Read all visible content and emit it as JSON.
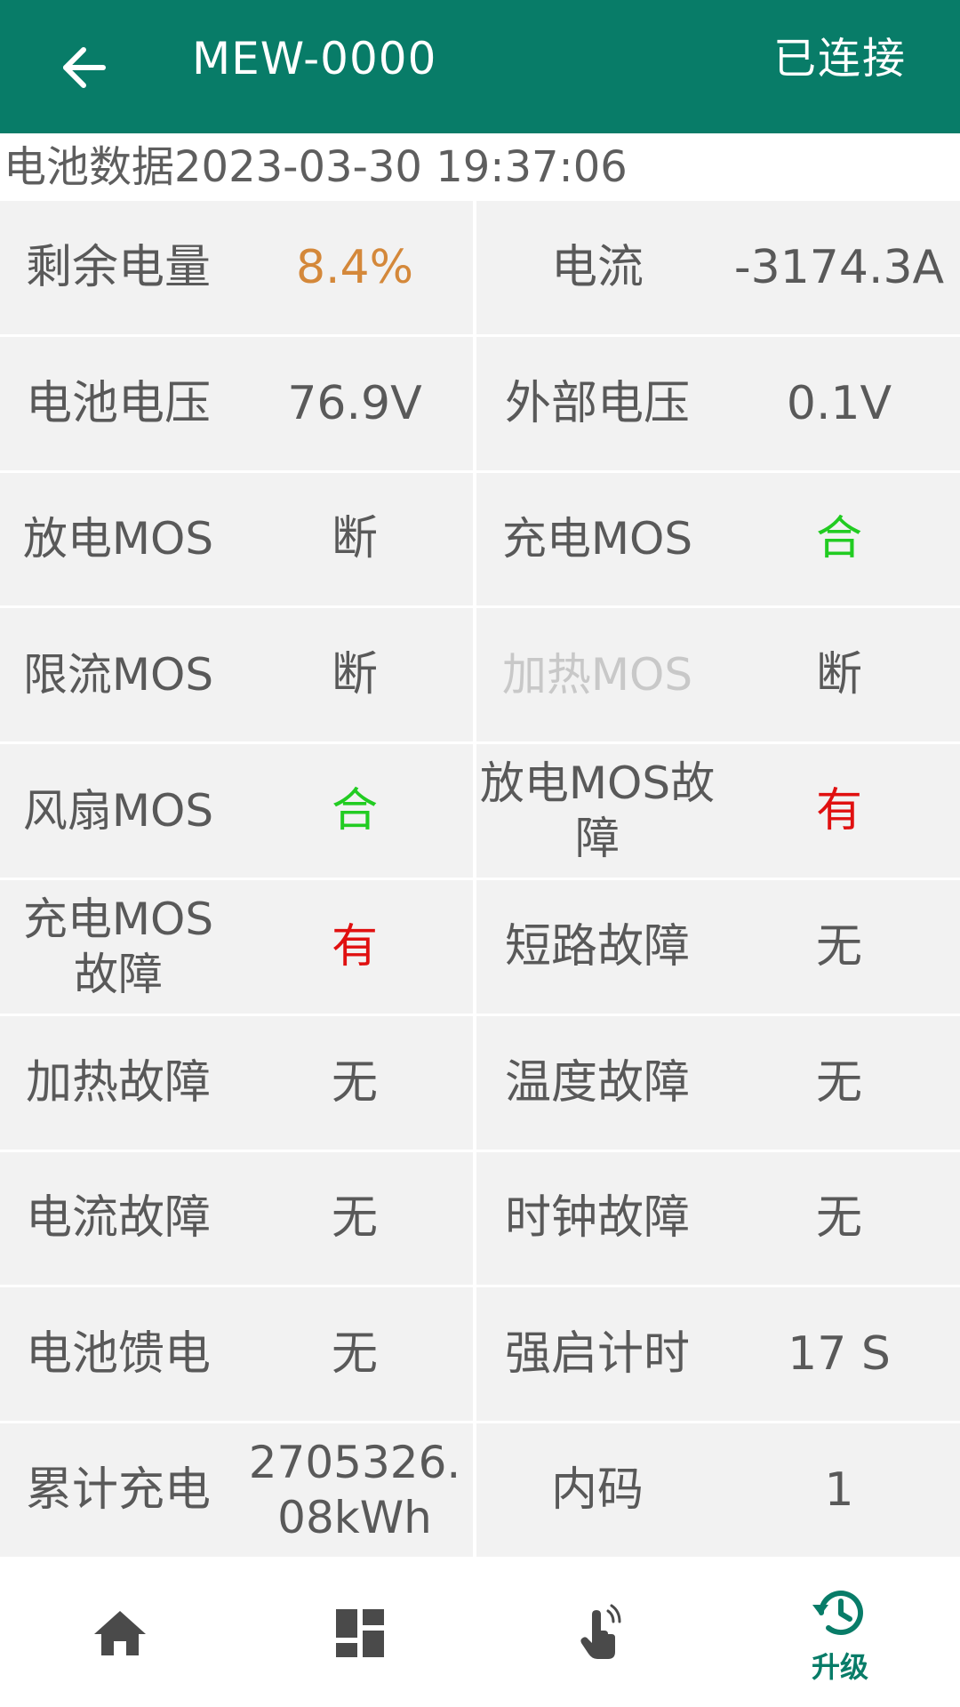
{
  "appbar": {
    "title": "MEW-0000",
    "status": "已连接",
    "back_icon": "arrow-left-icon",
    "bg_color": "#087c68"
  },
  "data_header": "电池数据2023-03-30 19:37:06",
  "cells": [
    {
      "label": "剩余电量",
      "value": "8.4%",
      "color": "#d4883a"
    },
    {
      "label": "电流",
      "value": "-3174.3A"
    },
    {
      "label": "电池电压",
      "value": "76.9V"
    },
    {
      "label": "外部电压",
      "value": "0.1V"
    },
    {
      "label": "放电MOS",
      "value": "断"
    },
    {
      "label": "充电MOS",
      "value": "合",
      "color": "#22cc22"
    },
    {
      "label": "限流MOS",
      "value": "断"
    },
    {
      "label": "加热MOS",
      "value": "断"
    },
    {
      "label": "风扇MOS",
      "value": "合",
      "color": "#22cc22"
    },
    {
      "label": "放电MOS故障",
      "value": "有",
      "color": "#e01010"
    },
    {
      "label": "充电MOS故障",
      "value": "有",
      "color": "#e01010"
    },
    {
      "label": "短路故障",
      "value": "无"
    },
    {
      "label": "加热故障",
      "value": "无"
    },
    {
      "label": "温度故障",
      "value": "无"
    },
    {
      "label": "电流故障",
      "value": "无"
    },
    {
      "label": "时钟故障",
      "value": "无"
    },
    {
      "label": "电池馈电",
      "value": "无"
    },
    {
      "label": "强启计时",
      "value": "17 S"
    },
    {
      "label": "累计充电",
      "value": "2705326.08kWh"
    },
    {
      "label": "内码",
      "value": "1"
    }
  ],
  "bottom_nav": [
    {
      "icon": "home-icon"
    },
    {
      "icon": "dashboard-icon"
    },
    {
      "icon": "touch-hand-icon"
    },
    {
      "icon": "upgrade-history-icon",
      "label": "升级",
      "active": true
    }
  ],
  "colors": {
    "cell_bg": "#f2f2f2",
    "text": "#595959",
    "accent_green": "#087c68"
  }
}
